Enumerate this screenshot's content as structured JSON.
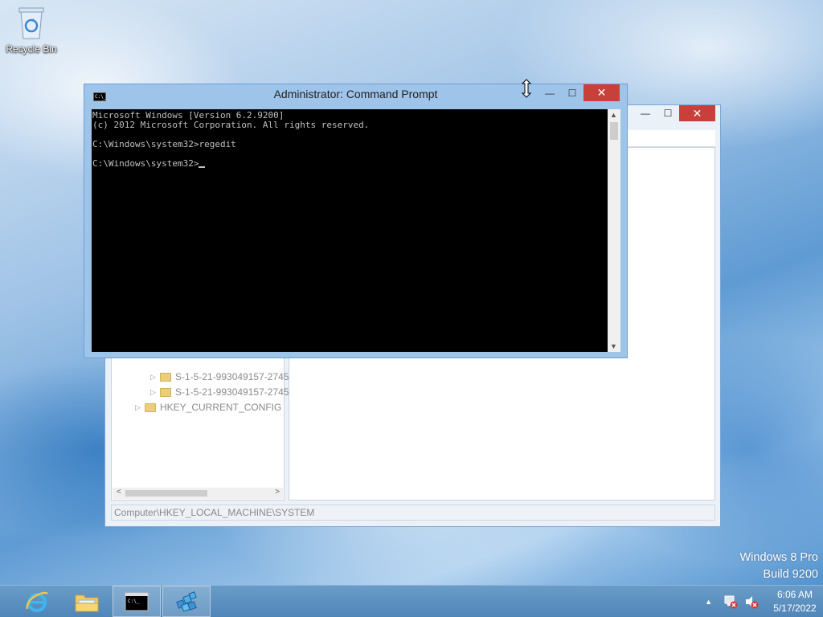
{
  "desktop": {
    "recycle_bin_label": "Recycle Bin",
    "watermark_line1": "Windows 8 Pro",
    "watermark_line2": "Build 9200"
  },
  "regedit": {
    "min_glyph": "—",
    "max_glyph": "☐",
    "close_glyph": "✕",
    "tree_items": [
      {
        "label": "S-1-5-21-993049157-2745",
        "level": 2
      },
      {
        "label": "S-1-5-21-993049157-2745",
        "level": 2
      },
      {
        "label": "HKEY_CURRENT_CONFIG",
        "level": 1
      }
    ],
    "status_path": "Computer\\HKEY_LOCAL_MACHINE\\SYSTEM"
  },
  "cmd": {
    "title": "Administrator: Command Prompt",
    "icon_text": "C:\\_",
    "min_glyph": "—",
    "max_glyph": "☐",
    "close_glyph": "✕",
    "lines": [
      "Microsoft Windows [Version 6.2.9200]",
      "(c) 2012 Microsoft Corporation. All rights reserved.",
      "",
      "C:\\Windows\\system32>regedit",
      "",
      "C:\\Windows\\system32>"
    ]
  },
  "taskbar": {
    "items": [
      "internet-explorer",
      "file-explorer",
      "command-prompt",
      "registry-editor"
    ],
    "active": "command-prompt",
    "tray_arrow": "▲",
    "clock_time": "6:06 AM",
    "clock_date": "5/17/2022"
  },
  "colors": {
    "close_red": "#c7403a",
    "cmd_frame": "#9ec4ea",
    "taskbar": "#5a90c0"
  }
}
